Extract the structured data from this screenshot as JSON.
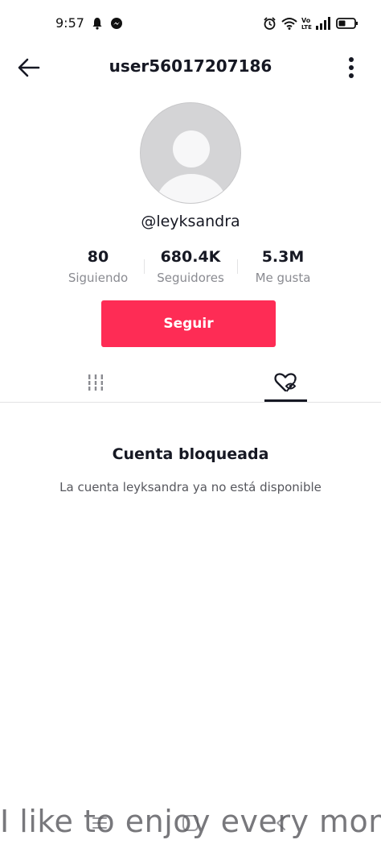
{
  "status_bar": {
    "time": "9:57",
    "left_icons": [
      "notification-bell-icon",
      "messenger-icon"
    ],
    "right_icons": [
      "alarm-icon",
      "wifi-icon",
      "volte-icon",
      "signal-icon",
      "battery-icon"
    ],
    "volte_label": "Vo LTE"
  },
  "header": {
    "title": "user56017207186",
    "back_icon": "arrow-left-icon",
    "more_icon": "more-vertical-icon"
  },
  "profile": {
    "username": "@leyksandra",
    "stats": [
      {
        "value": "80",
        "label": "Siguiendo"
      },
      {
        "value": "680.4K",
        "label": "Seguidores"
      },
      {
        "value": "5.3M",
        "label": "Me gusta"
      }
    ],
    "follow_label": "Seguir"
  },
  "tabs": [
    {
      "icon": "videos-grid-icon",
      "active": false
    },
    {
      "icon": "liked-hidden-icon",
      "active": true
    }
  ],
  "content": {
    "blocked_title": "Cuenta bloqueada",
    "blocked_message": "La cuenta leyksandra ya no está disponible"
  },
  "system_nav": [
    "menu-icon",
    "home-icon",
    "back-icon"
  ],
  "overlay_caption": "I like to enjoy every mom",
  "colors": {
    "accent": "#fe2c55",
    "text_primary": "#161823",
    "text_secondary": "#8a8b91",
    "avatar_bg": "#d4d4d6"
  }
}
